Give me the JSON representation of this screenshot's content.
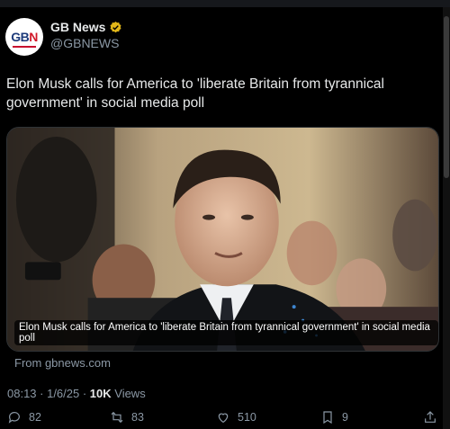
{
  "account": {
    "name": "GB News",
    "handle": "@GBNEWS",
    "logo_text_left": "GB",
    "logo_text_right": "N",
    "verified_color": "#e2b719"
  },
  "tweet": {
    "text": "Elon Musk calls for America to 'liberate Britain from tyrannical government' in social media poll",
    "card_caption": "Elon Musk calls for America to 'liberate Britain from tyrannical government' in social media poll",
    "source": "From gbnews.com",
    "time": "08:13 · 1/6/25 · ",
    "views_count": "10K",
    "views_label": " Views"
  },
  "actions": {
    "replies": "82",
    "reposts": "83",
    "likes": "510",
    "bookmarks": "9"
  }
}
